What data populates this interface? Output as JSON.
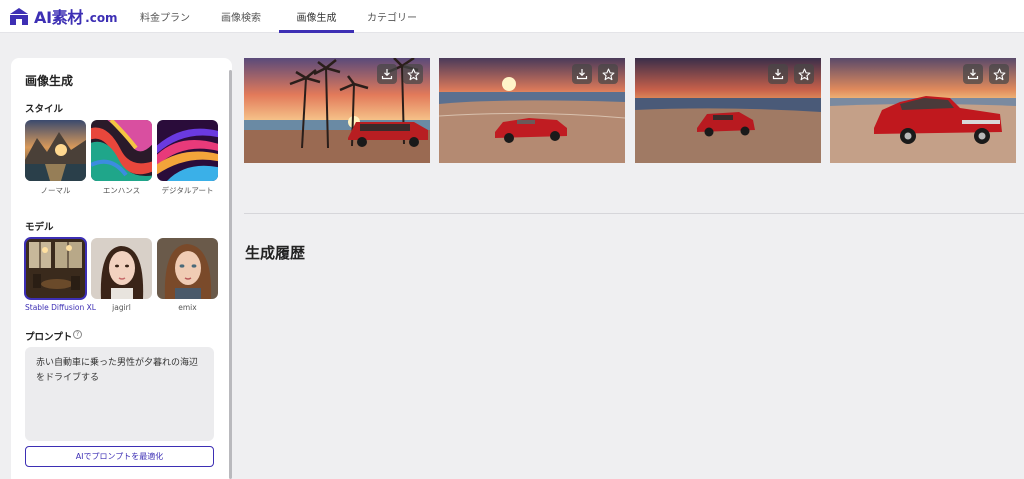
{
  "brand": {
    "name": "AI素材",
    "suffix": ".com",
    "accent": "#3d2fb4"
  },
  "nav": {
    "tabs": [
      {
        "label": "料金プラン"
      },
      {
        "label": "画像検索"
      },
      {
        "label": "画像生成",
        "active": true
      },
      {
        "label": "カテゴリー"
      }
    ]
  },
  "sidebar": {
    "title": "画像生成",
    "style_label": "スタイル",
    "styles": [
      {
        "label": "ノーマル"
      },
      {
        "label": "エンハンス"
      },
      {
        "label": "デジタルアート"
      }
    ],
    "model_label": "モデル",
    "models": [
      {
        "label": "Stable Diffusion XL",
        "selected": true
      },
      {
        "label": "jagirl"
      },
      {
        "label": "emix"
      }
    ],
    "prompt_label": "プロンプト",
    "prompt_help_icon": "question-circle-icon",
    "prompt_text": "赤い自動車に乗った男性が夕暮れの海辺をドライブする",
    "optimize_button": "AIでプロンプトを最適化"
  },
  "results": {
    "images": [
      {
        "subject": "red wagon under palm trees at sunset beach",
        "icons": [
          "download-icon",
          "star-icon"
        ]
      },
      {
        "subject": "red convertible on sunset beach",
        "icons": [
          "download-icon",
          "star-icon"
        ]
      },
      {
        "subject": "red SUV on sunset beach",
        "icons": [
          "download-icon",
          "star-icon"
        ]
      },
      {
        "subject": "red classic muscle car on sunset beach",
        "icons": [
          "download-icon",
          "star-icon"
        ]
      }
    ]
  },
  "history": {
    "title": "生成履歴"
  }
}
